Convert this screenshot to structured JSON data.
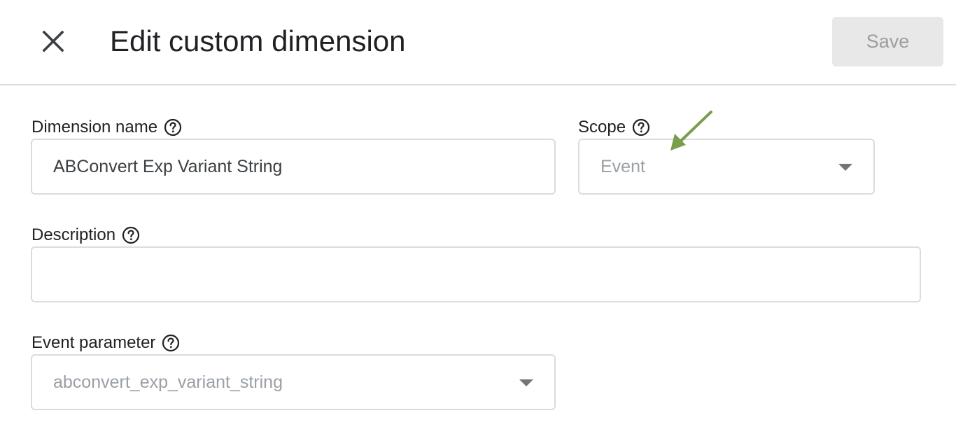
{
  "header": {
    "title": "Edit custom dimension",
    "save_label": "Save",
    "close_icon": "close-icon"
  },
  "form": {
    "dimension_name": {
      "label": "Dimension name",
      "value": "ABConvert Exp Variant String"
    },
    "scope": {
      "label": "Scope",
      "value": "Event"
    },
    "description": {
      "label": "Description",
      "value": ""
    },
    "event_parameter": {
      "label": "Event parameter",
      "value": "abconvert_exp_variant_string"
    }
  },
  "colors": {
    "annotation_arrow": "#7a9e4b",
    "border": "#dadce0",
    "disabled_text": "#9aa0a6",
    "save_bg": "#e8e8e8"
  }
}
